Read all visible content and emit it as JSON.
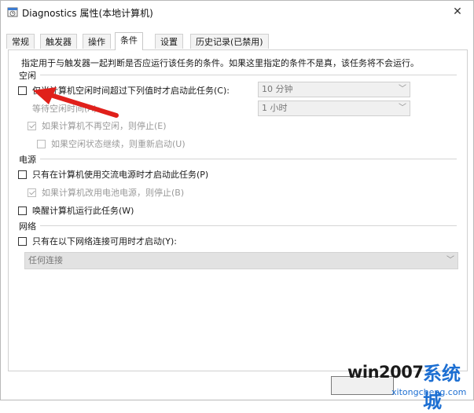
{
  "window": {
    "title": "Diagnostics 属性(本地计算机)",
    "close_glyph": "✕"
  },
  "tabs": [
    {
      "label": "常规",
      "active": false
    },
    {
      "label": "触发器",
      "active": false
    },
    {
      "label": "操作",
      "active": false
    },
    {
      "label": "条件",
      "active": true
    },
    {
      "label": "设置",
      "active": false
    },
    {
      "label": "历史记录(已禁用)",
      "active": false
    }
  ],
  "description": "指定用于与触发器一起判断是否应运行该任务的条件。如果这里指定的条件不是真，该任务将不会运行。",
  "idle": {
    "section_label": "空闲",
    "start_if_idle": {
      "label": "仅当计算机空闲时间超过下列值时才启动此任务(C):",
      "checked": false
    },
    "idle_duration": {
      "value": "10 分钟"
    },
    "wait_for_idle": {
      "label": "等待空闲时间(A):"
    },
    "wait_duration": {
      "value": "1 小时"
    },
    "stop_if_not_idle": {
      "label": "如果计算机不再空闲，则停止(E)",
      "checked": true
    },
    "restart_if_idle_resumes": {
      "label": "如果空闲状态继续，则重新启动(U)",
      "checked": false
    }
  },
  "power": {
    "section_label": "电源",
    "ac_only": {
      "label": "只有在计算机使用交流电源时才启动此任务(P)",
      "checked": false
    },
    "stop_on_battery": {
      "label": "如果计算机改用电池电源，则停止(B)",
      "checked": true
    },
    "wake_to_run": {
      "label": "唤醒计算机运行此任务(W)",
      "checked": false
    }
  },
  "network": {
    "section_label": "网络",
    "only_if_network": {
      "label": "只有在以下网络连接可用时才启动(Y):",
      "checked": false
    },
    "connection": {
      "value": "任何连接"
    }
  },
  "watermark": {
    "text": "win2007",
    "cn": "系统城",
    "url": "xitongcheng.com"
  },
  "colors": {
    "arrow": "#e0201b",
    "watermark_blue": "#1d6fd2"
  },
  "icons": {
    "title": "task-scheduler-icon",
    "chevron": "chevron-down-icon",
    "close": "close-icon"
  }
}
